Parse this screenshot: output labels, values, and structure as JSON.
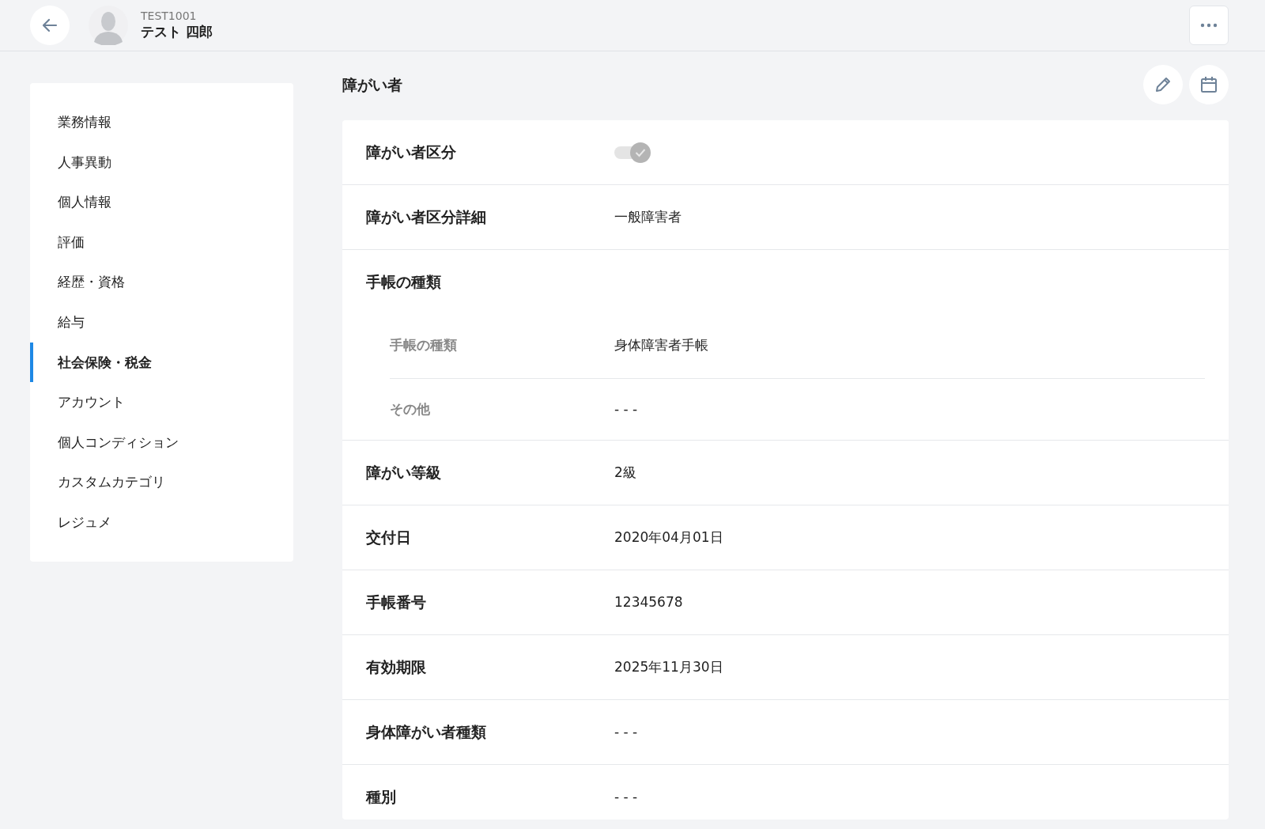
{
  "header": {
    "employee_code": "TEST1001",
    "employee_name": "テスト 四郎"
  },
  "sidebar": {
    "items": [
      {
        "label": "業務情報",
        "selected": false
      },
      {
        "label": "人事異動",
        "selected": false
      },
      {
        "label": "個人情報",
        "selected": false
      },
      {
        "label": "評価",
        "selected": false
      },
      {
        "label": "経歴・資格",
        "selected": false
      },
      {
        "label": "給与",
        "selected": false
      },
      {
        "label": "社会保険・税金",
        "selected": true
      },
      {
        "label": "アカウント",
        "selected": false
      },
      {
        "label": "個人コンディション",
        "selected": false
      },
      {
        "label": "カスタムカテゴリ",
        "selected": false
      },
      {
        "label": "レジュメ",
        "selected": false
      }
    ]
  },
  "section": {
    "title": "障がい者",
    "rows": [
      {
        "kind": "toggle",
        "label": "障がい者区分",
        "on": true,
        "disabled": true
      },
      {
        "kind": "text",
        "label": "障がい者区分詳細",
        "value": "一般障害者"
      },
      {
        "kind": "group",
        "label": "手帳の種類",
        "children": [
          {
            "label": "手帳の種類",
            "value": "身体障害者手帳"
          },
          {
            "label": "その他",
            "value": "- - -"
          }
        ]
      },
      {
        "kind": "text",
        "label": "障がい等級",
        "value": "2級"
      },
      {
        "kind": "text",
        "label": "交付日",
        "value": "2020年04月01日"
      },
      {
        "kind": "text",
        "label": "手帳番号",
        "value": "12345678"
      },
      {
        "kind": "text",
        "label": "有効期限",
        "value": "2025年11月30日"
      },
      {
        "kind": "text",
        "label": "身体障がい者種類",
        "value": "- - -"
      },
      {
        "kind": "text",
        "label": "種別",
        "value": "- - -"
      }
    ]
  }
}
